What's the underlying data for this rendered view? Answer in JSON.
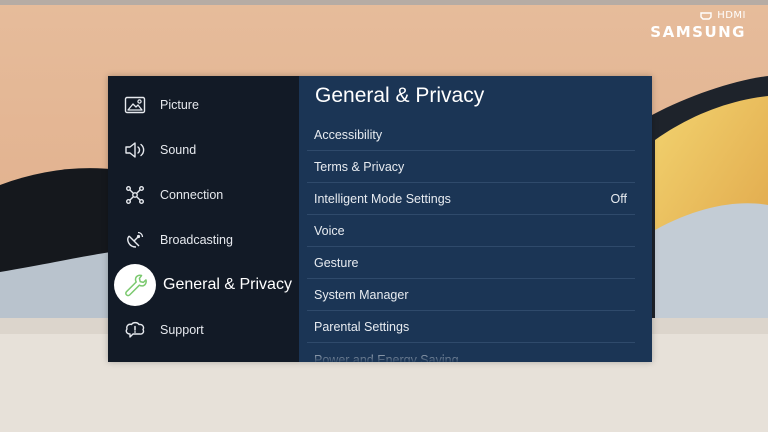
{
  "brand": {
    "source_label": "HDMI",
    "logo_text": "SAMSUNG"
  },
  "sidebar": {
    "items": [
      {
        "label": "Picture",
        "icon": "picture-icon"
      },
      {
        "label": "Sound",
        "icon": "sound-icon"
      },
      {
        "label": "Connection",
        "icon": "connection-icon"
      },
      {
        "label": "Broadcasting",
        "icon": "broadcasting-icon"
      },
      {
        "label": "General & Privacy",
        "icon": "wrench-icon",
        "selected": true
      },
      {
        "label": "Support",
        "icon": "support-icon"
      }
    ]
  },
  "main": {
    "title": "General & Privacy",
    "items": [
      {
        "label": "Accessibility",
        "value": ""
      },
      {
        "label": "Terms & Privacy",
        "value": ""
      },
      {
        "label": "Intelligent Mode Settings",
        "value": "Off"
      },
      {
        "label": "Voice",
        "value": ""
      },
      {
        "label": "Gesture",
        "value": ""
      },
      {
        "label": "System Manager",
        "value": ""
      },
      {
        "label": "Parental Settings",
        "value": ""
      },
      {
        "label": "Power and Energy Saving",
        "value": ""
      }
    ]
  },
  "colors": {
    "sidebar_bg": "#121a26",
    "panel_bg": "#1b3555",
    "selected_icon_bg": "#ffffff",
    "selected_icon_color": "#7bc96f"
  }
}
